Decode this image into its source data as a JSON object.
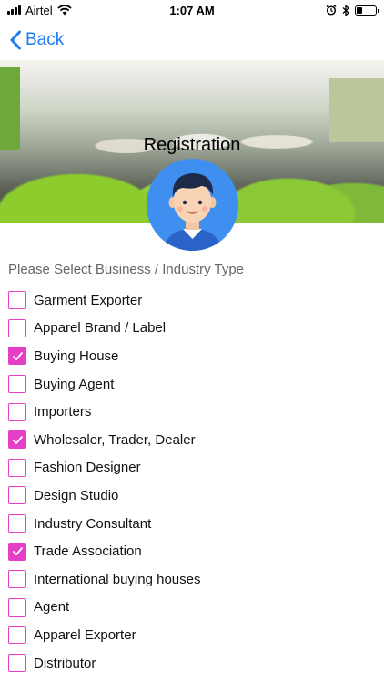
{
  "status_bar": {
    "carrier": "Airtel",
    "time": "1:07 AM"
  },
  "nav": {
    "back_label": "Back"
  },
  "hero": {
    "title": "Registration"
  },
  "section": {
    "title": "Please Select Business / Industry Type"
  },
  "options": [
    {
      "label": "Garment Exporter",
      "checked": false
    },
    {
      "label": "Apparel Brand / Label",
      "checked": false
    },
    {
      "label": "Buying House",
      "checked": true
    },
    {
      "label": "Buying Agent",
      "checked": false
    },
    {
      "label": "Importers",
      "checked": false
    },
    {
      "label": "Wholesaler, Trader, Dealer",
      "checked": true
    },
    {
      "label": "Fashion Designer",
      "checked": false
    },
    {
      "label": "Design Studio",
      "checked": false
    },
    {
      "label": "Industry Consultant",
      "checked": false
    },
    {
      "label": "Trade Association",
      "checked": true
    },
    {
      "label": "International buying houses",
      "checked": false
    },
    {
      "label": "Agent",
      "checked": false
    },
    {
      "label": "Apparel Exporter",
      "checked": false
    },
    {
      "label": "Distributor",
      "checked": false
    }
  ],
  "colors": {
    "accent": "#e63fc7",
    "link": "#1e7cf2",
    "avatar_bg": "#3f8ff0"
  }
}
